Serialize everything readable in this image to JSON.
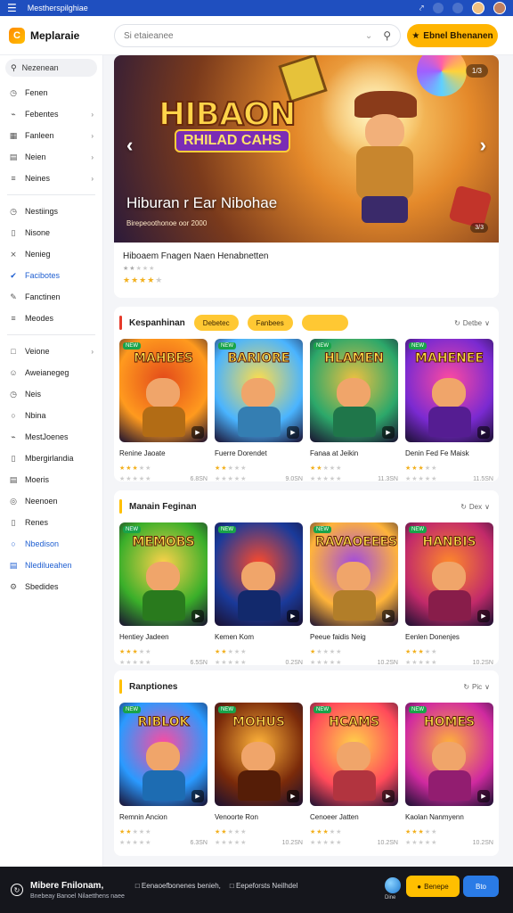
{
  "topbar": {
    "title": "Mestherspilghiae"
  },
  "header": {
    "logo_text": "Meplaraie",
    "search_placeholder": "Si etaieanee",
    "cta_label": "Ebnel Bhenanen"
  },
  "sidebar": {
    "search_label": "Nezenean",
    "group1": [
      {
        "label": "Fenen",
        "icon": "clock-icon",
        "caret": false
      },
      {
        "label": "Febentes",
        "icon": "tag-icon",
        "caret": true
      },
      {
        "label": "Fanleen",
        "icon": "calendar-icon",
        "caret": true
      },
      {
        "label": "Neien",
        "icon": "grid-icon",
        "caret": true
      },
      {
        "label": "Neines",
        "icon": "list-icon",
        "caret": true
      }
    ],
    "group2": [
      {
        "label": "Nestiings",
        "icon": "clock-icon"
      },
      {
        "label": "Nisone",
        "icon": "doc-icon"
      },
      {
        "label": "Nenieg",
        "icon": "shuffle-icon"
      },
      {
        "label": "Facibotes",
        "icon": "check-icon",
        "active": true
      },
      {
        "label": "Fanctinen",
        "icon": "edit-icon"
      },
      {
        "label": "Meodes",
        "icon": "list-icon"
      }
    ],
    "group3": [
      {
        "label": "Veione",
        "icon": "folder-icon",
        "caret": true
      },
      {
        "label": "Aweianegeg",
        "icon": "person-icon"
      },
      {
        "label": "Neis",
        "icon": "clock-icon"
      },
      {
        "label": "Nbina",
        "icon": "chat-icon"
      },
      {
        "label": "MestJoenes",
        "icon": "tag-icon"
      },
      {
        "label": "Mbergirlandia",
        "icon": "doc-icon"
      },
      {
        "label": "Moeris",
        "icon": "grid-icon"
      },
      {
        "label": "Neenoen",
        "icon": "globe-icon"
      },
      {
        "label": "Renes",
        "icon": "doc-icon"
      },
      {
        "label": "Nbedison",
        "icon": "chat-icon",
        "active": true
      },
      {
        "label": "Nledilueahen",
        "icon": "grid-icon",
        "active": true
      },
      {
        "label": "Sbedides",
        "icon": "gear-icon"
      }
    ]
  },
  "hero": {
    "logo_line1": "HIBAON",
    "logo_line2": "RHILAD CAHS",
    "caption": "Hiburan r Ear Nibohae",
    "sub": "Birepeoothonoe oor 2000",
    "counter": "1/3",
    "badge": "3/3",
    "info_title": "Hiboaem Fnagen Naen Henabnetten",
    "info_rating": 4
  },
  "sections": [
    {
      "title": "Kespanhinan",
      "chips": [
        "Debetec",
        "Fanbees",
        ""
      ],
      "more": "Detbe",
      "cards": [
        {
          "title": "MAHBES",
          "name": "Renine Jaoate",
          "rating": 3,
          "count": "6.8SN",
          "colors": [
            "#ff9a1e",
            "#e34a1a"
          ]
        },
        {
          "title": "BARIORE",
          "name": "Fuerre Dorendet",
          "rating": 2,
          "count": "9.0SN",
          "colors": [
            "#4ab4ff",
            "#ffdd4a"
          ]
        },
        {
          "title": "HLAMEN",
          "name": "Fanaa at Jeikin",
          "rating": 2,
          "count": "11.3SN",
          "colors": [
            "#2ca86a",
            "#f0c040"
          ]
        },
        {
          "title": "MAHENEE",
          "name": "Denin Fed Fe Maisk",
          "rating": 3,
          "count": "11.5SN",
          "colors": [
            "#7a2ad1",
            "#ff4aa0"
          ]
        }
      ]
    },
    {
      "title": "Manain Feginan",
      "chips": [],
      "more": "Dex",
      "cards": [
        {
          "title": "MEMOBS",
          "name": "Hentiey Jadeen",
          "rating": 3,
          "count": "6.5SN",
          "colors": [
            "#3aaf2a",
            "#ffd24a"
          ]
        },
        {
          "title": "",
          "name": "Kemen Kom",
          "rating": 2,
          "count": "0.2SN",
          "colors": [
            "#1a3a9a",
            "#ff4a2a"
          ]
        },
        {
          "title": "RAVAOEEES",
          "name": "Peeue faidis Neig",
          "rating": 1,
          "count": "10.2SN",
          "colors": [
            "#ffb43a",
            "#a04ae0"
          ]
        },
        {
          "title": "HANBIS",
          "name": "Eenlen Donenjes",
          "rating": 3,
          "count": "10.2SN",
          "colors": [
            "#c22a6a",
            "#ff8a2a"
          ]
        }
      ]
    },
    {
      "title": "Ranptiones",
      "chips": [],
      "more": "Pic",
      "cards": [
        {
          "title": "RIBLOK",
          "name": "Remnin Ancion",
          "rating": 2,
          "count": "6.3SN",
          "colors": [
            "#2a9aff",
            "#ff4aa0"
          ]
        },
        {
          "title": "MOHUS",
          "name": "Venoorte Ron",
          "rating": 2,
          "count": "10.2SN",
          "colors": [
            "#7a2a0a",
            "#ffb43a"
          ]
        },
        {
          "title": "HCAMS",
          "name": "Cenoeer Jatten",
          "rating": 3,
          "count": "10.2SN",
          "colors": [
            "#ff4a5a",
            "#ffd24a"
          ]
        },
        {
          "title": "HOMES",
          "name": "Kaolan Nanmyenn",
          "rating": 3,
          "count": "10.2SN",
          "colors": [
            "#d02aa0",
            "#ffb43a"
          ]
        }
      ]
    }
  ],
  "bottombar": {
    "title": "Mibere Fnilonam,",
    "sub": "Bnebeay Banoel Nilaetthens naee",
    "link1": "Eenaoefbonenes benieh,",
    "link2": "Eepeforsts Neilhdel",
    "ball_label": "Dine",
    "btn1": "Benepe",
    "btn2": "Bto"
  }
}
